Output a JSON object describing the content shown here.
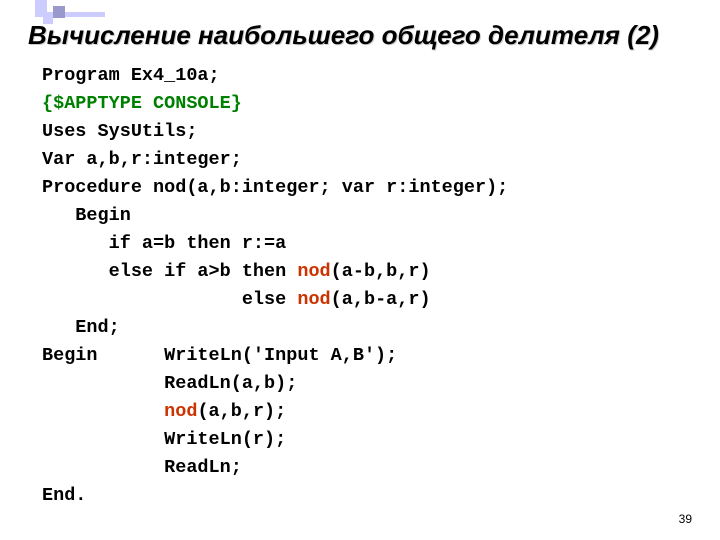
{
  "title": "Вычисление наибольшего общего делителя (2)",
  "code": {
    "l1": "Program Ex4_10a;",
    "l2": "{$APPTYPE CONSOLE}",
    "l3": "Uses SysUtils;",
    "l4": "Var a,b,r:integer;",
    "l5": "Procedure nod(a,b:integer; var r:integer);",
    "l6": "   Begin",
    "l7a": "      if a=b then r:=a",
    "l8a": "      else if a>b then ",
    "l8b": "nod",
    "l8c": "(a-b,b,r)",
    "l9a": "                  else ",
    "l9b": "nod",
    "l9c": "(a,b-a,r)",
    "l10": "   End;",
    "l11": "Begin      WriteLn('Input A,B');",
    "l12": "           ReadLn(a,b);",
    "l13a": "           ",
    "l13b": "nod",
    "l13c": "(a,b,r);",
    "l14": "           WriteLn(r);",
    "l15": "           ReadLn;",
    "l16": "End."
  },
  "page_number": "39"
}
